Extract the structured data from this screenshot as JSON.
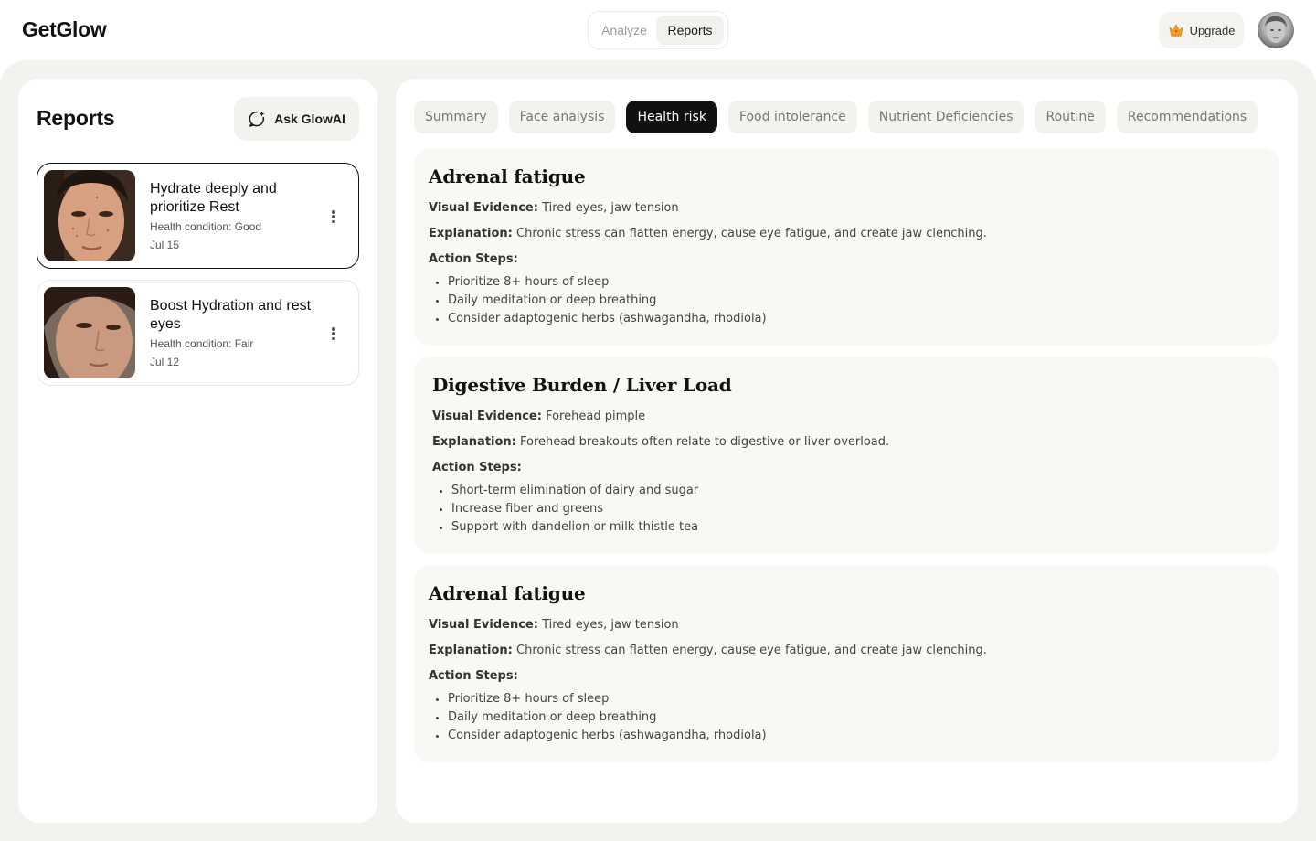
{
  "app": {
    "logo": "GetGlow"
  },
  "nav": {
    "analyze": "Analyze",
    "reports": "Reports",
    "upgrade": "Upgrade"
  },
  "sidebar": {
    "title": "Reports",
    "ask_button": "Ask GlowAI",
    "reports": [
      {
        "title": "Hydrate deeply and prioritize Rest",
        "condition": "Health condition: Good",
        "date": "Jul 15",
        "selected": true
      },
      {
        "title": "Boost Hydration and rest eyes",
        "condition": "Health condition: Fair",
        "date": "Jul 12",
        "selected": false
      }
    ]
  },
  "tabs": [
    {
      "label": "Summary",
      "active": false
    },
    {
      "label": "Face analysis",
      "active": false
    },
    {
      "label": "Health risk",
      "active": true
    },
    {
      "label": "Food intolerance",
      "active": false
    },
    {
      "label": "Nutrient Deficiencies",
      "active": false
    },
    {
      "label": "Routine",
      "active": false
    },
    {
      "label": "Recommendations",
      "active": false
    }
  ],
  "labels": {
    "visual_evidence": "Visual Evidence:",
    "explanation": "Explanation:",
    "action_steps": "Action Steps:"
  },
  "risks": [
    {
      "title": "Adrenal fatigue",
      "visual_evidence": "Tired eyes, jaw tension",
      "explanation": "Chronic stress can flatten energy, cause eye fatigue, and create jaw clenching.",
      "steps": [
        "Prioritize 8+ hours of sleep",
        "Daily meditation or deep breathing",
        "Consider adaptogenic herbs (ashwagandha, rhodiola)"
      ]
    },
    {
      "title": "Digestive Burden / Liver Load",
      "visual_evidence": "Forehead pimple",
      "explanation": "Forehead breakouts often relate to digestive or liver overload.",
      "steps": [
        "Short-term elimination of dairy and sugar",
        "Increase fiber and greens",
        "Support with dandelion or milk thistle tea"
      ]
    },
    {
      "title": "Adrenal fatigue",
      "visual_evidence": "Tired eyes, jaw tension",
      "explanation": "Chronic stress can flatten energy, cause eye fatigue, and create jaw clenching.",
      "steps": [
        "Prioritize 8+ hours of sleep",
        "Daily meditation or deep breathing",
        "Consider adaptogenic herbs (ashwagandha, rhodiola)"
      ]
    }
  ],
  "colors": {
    "frame_bg": "#f2f2ee",
    "active_tab": "#111111",
    "card_bg": "#f8f8f5"
  }
}
